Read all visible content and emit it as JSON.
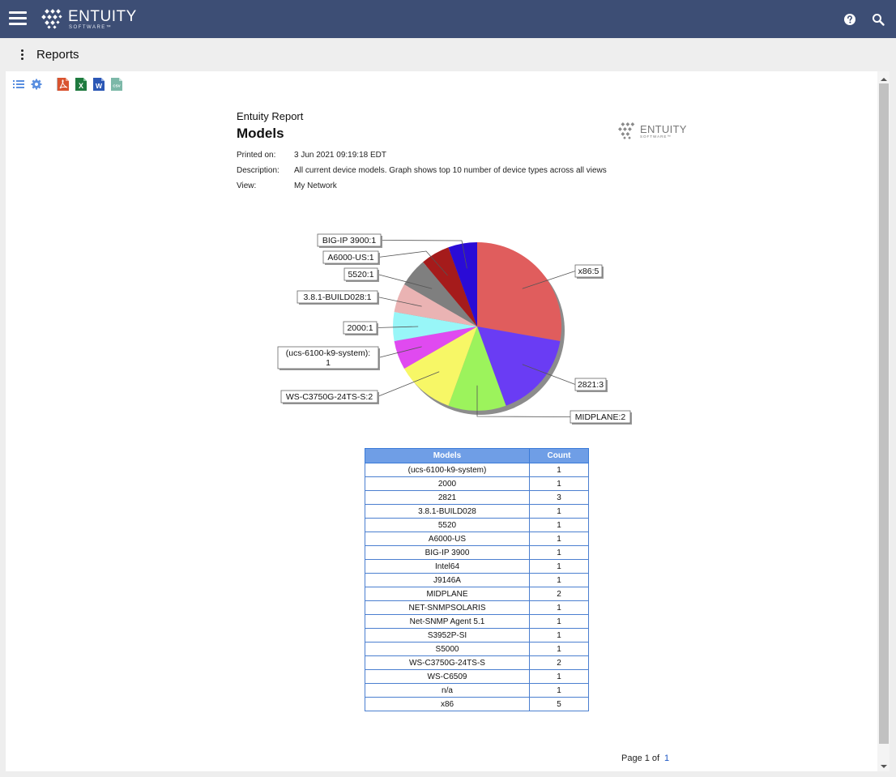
{
  "app": {
    "brand": "ENTUITY",
    "brand_sub": "SOFTWARE™"
  },
  "header": {
    "icons": [
      "hamburger-menu-icon",
      "help-icon",
      "search-icon"
    ]
  },
  "subheader": {
    "title": "Reports"
  },
  "toolbar": {
    "icons": [
      "list-icon",
      "gear-icon",
      "pdf-icon",
      "excel-icon",
      "word-icon",
      "csv-icon"
    ],
    "excel_glyph": "X",
    "word_glyph": "W",
    "csv_glyph": "CSV"
  },
  "report": {
    "kicker": "Entuity Report",
    "title": "Models",
    "meta": [
      {
        "label": "Printed on:",
        "value": "3 Jun 2021 09:19:18 EDT"
      },
      {
        "label": "Description:",
        "value": "All current device models. Graph shows top 10 number of device types across all views"
      },
      {
        "label": "View:",
        "value": "My Network"
      }
    ]
  },
  "chart_data": {
    "type": "pie",
    "slices": [
      {
        "label": "x86:5",
        "value": 5,
        "color": "#e05d5d"
      },
      {
        "label": "2821:3",
        "value": 3,
        "color": "#6a3cf4"
      },
      {
        "label": "MIDPLANE:2",
        "value": 2,
        "color": "#9cf35c"
      },
      {
        "label": "WS-C3750G-24TS-S:2",
        "value": 2,
        "color": "#f7f766"
      },
      {
        "label": "(ucs-6100-k9-system):1",
        "value": 1,
        "color": "#e04af0"
      },
      {
        "label": "2000:1",
        "value": 1,
        "color": "#98f6f8"
      },
      {
        "label": "3.8.1-BUILD028:1",
        "value": 1,
        "color": "#eab3b3"
      },
      {
        "label": "5520:1",
        "value": 1,
        "color": "#7f7f7f"
      },
      {
        "label": "A6000-US:1",
        "value": 1,
        "color": "#a51b1b"
      },
      {
        "label": "BIG-IP 3900:1",
        "value": 1,
        "color": "#2a0bd6"
      }
    ]
  },
  "table": {
    "headers": [
      "Models",
      "Count"
    ],
    "rows": [
      [
        "(ucs-6100-k9-system)",
        "1"
      ],
      [
        "2000",
        "1"
      ],
      [
        "2821",
        "3"
      ],
      [
        "3.8.1-BUILD028",
        "1"
      ],
      [
        "5520",
        "1"
      ],
      [
        "A6000-US",
        "1"
      ],
      [
        "BIG-IP 3900",
        "1"
      ],
      [
        "Intel64",
        "1"
      ],
      [
        "J9146A",
        "1"
      ],
      [
        "MIDPLANE",
        "2"
      ],
      [
        "NET-SNMPSOLARIS",
        "1"
      ],
      [
        "Net-SNMP Agent 5.1",
        "1"
      ],
      [
        "S3952P-SI",
        "1"
      ],
      [
        "S5000",
        "1"
      ],
      [
        "WS-C3750G-24TS-S",
        "2"
      ],
      [
        "WS-C6509",
        "1"
      ],
      [
        "n/a",
        "1"
      ],
      [
        "x86",
        "5"
      ]
    ]
  },
  "footer": {
    "page_label": "Page 1 of",
    "page_total": "1"
  }
}
